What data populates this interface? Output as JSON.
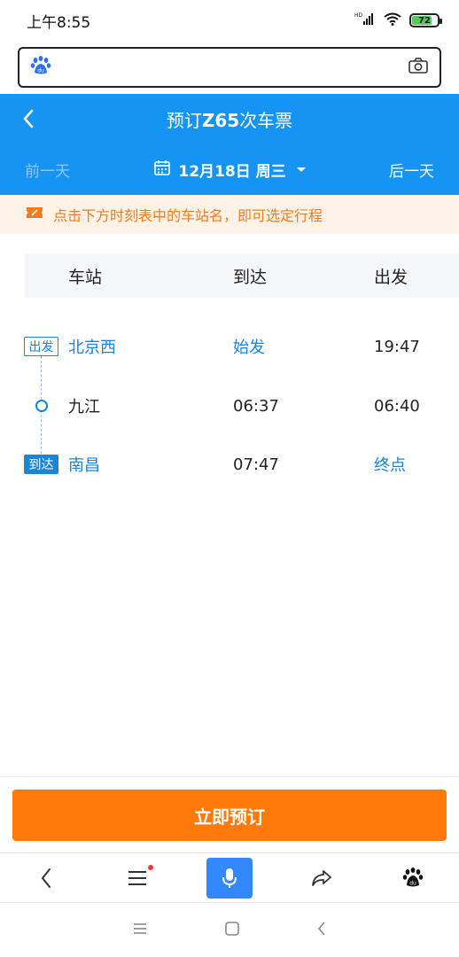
{
  "status": {
    "time": "上午8:55",
    "battery": "72",
    "network": "HD"
  },
  "search": {
    "placeholder": ""
  },
  "header": {
    "title_prefix": "预订",
    "train_no": "Z65",
    "title_suffix": "次车票",
    "prev_day": "前一天",
    "date": "12月18日 周三",
    "next_day": "后一天"
  },
  "tip": {
    "text": "点击下方时刻表中的车站名，即可选定行程"
  },
  "table": {
    "headers": {
      "station": "车站",
      "arrive": "到达",
      "depart": "出发"
    },
    "rows": [
      {
        "tag": "出发",
        "station": "北京西",
        "arrive": "始发",
        "depart": "19:47"
      },
      {
        "tag": "",
        "station": "九江",
        "arrive": "06:37",
        "depart": "06:40"
      },
      {
        "tag": "到达",
        "station": "南昌",
        "arrive": "07:47",
        "depart": "终点"
      }
    ]
  },
  "book_button": "立即预订",
  "colors": {
    "primary": "#1694f3",
    "accent": "#ff7a0a",
    "link": "#1984d8",
    "tip_bg": "#fff3e8",
    "tip_text": "#f37b1d"
  },
  "icons": {
    "back": "chevron-left-icon",
    "menu": "menu-icon",
    "mic": "mic-icon",
    "share": "share-icon",
    "baidu": "baidu-paw-icon",
    "camera": "camera-icon",
    "calendar": "calendar-icon"
  }
}
